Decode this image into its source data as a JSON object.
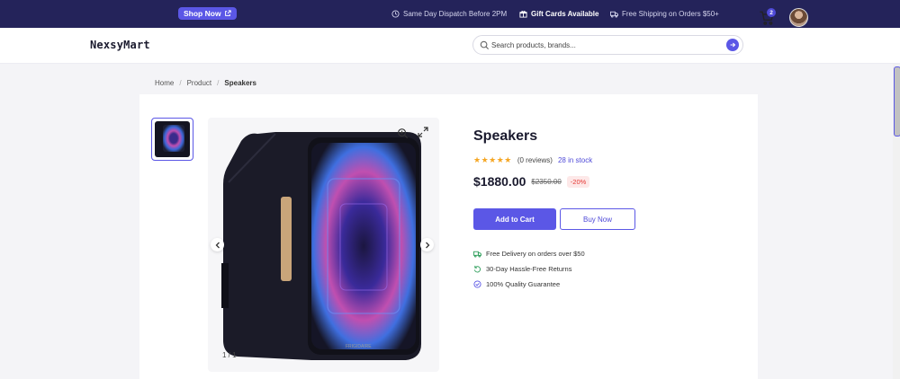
{
  "promo": {
    "shop_now": "Shop Now",
    "items": [
      "Same Day Dispatch Before 2PM",
      "Gift Cards Available",
      "Free Shipping on Orders $50+"
    ]
  },
  "header": {
    "logo": "NexsyMart",
    "search_placeholder": "Search products, brands...",
    "cart_count": "2"
  },
  "breadcrumb": [
    "Home",
    "Product",
    "Speakers"
  ],
  "gallery": {
    "counter": "1 / 1"
  },
  "product": {
    "title": "Speakers",
    "stars": "★★★★★",
    "reviews": "(0 reviews)",
    "stock": "28 in stock",
    "price": "$1880.00",
    "old_price": "$2350.00",
    "discount": "-20%",
    "add_to_cart": "Add to Cart",
    "buy_now": "Buy Now",
    "features": [
      "Free Delivery on orders over $50",
      "30-Day Hassle-Free Returns",
      "100% Quality Guarantee"
    ]
  },
  "colors": {
    "accent": "#5b57e6",
    "promo_bg": "#24235a",
    "star": "#f5a623",
    "discount": "#e53935",
    "feature_icon": "#2e9e5b"
  },
  "icons": [
    "external-link-icon",
    "clock-icon",
    "gift-icon",
    "truck-icon",
    "search-icon",
    "arrow-right-icon",
    "cart-icon",
    "zoom-in-icon",
    "expand-icon",
    "chevron-left-icon",
    "chevron-right-icon",
    "return-icon",
    "check-shield-icon"
  ]
}
